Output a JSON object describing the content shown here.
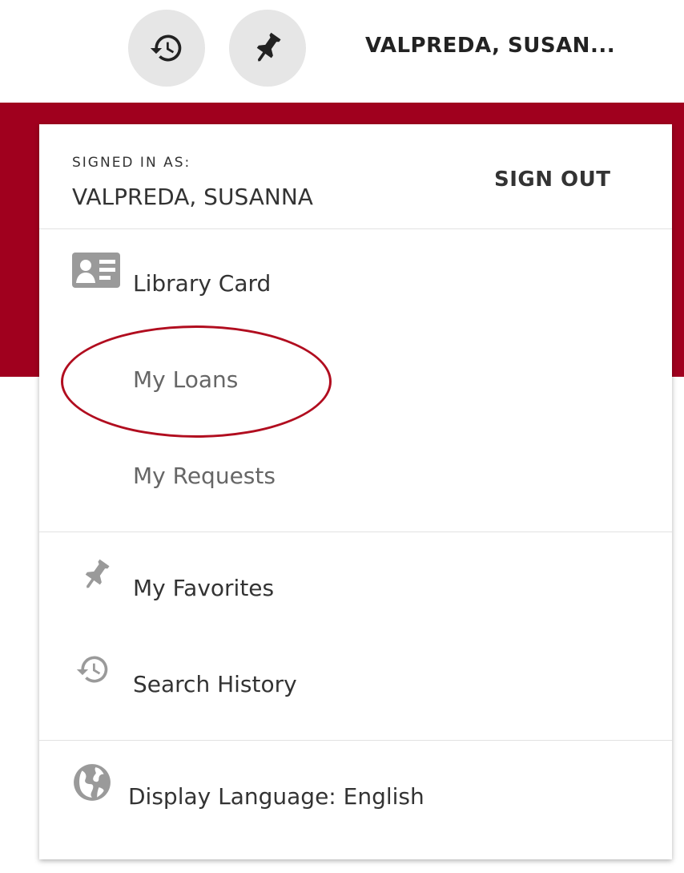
{
  "header": {
    "history_icon": "history-icon",
    "pin_icon": "pin-icon",
    "username_truncated": "VALPREDA, SUSAN..."
  },
  "menu": {
    "signed_in_label": "SIGNED IN AS:",
    "user_name": "VALPREDA, SUSANNA",
    "sign_out_label": "SIGN OUT",
    "items": [
      {
        "label": "Library Card",
        "icon": "id-card-icon"
      },
      {
        "label": "My Loans",
        "icon": ""
      },
      {
        "label": "My Requests",
        "icon": ""
      },
      {
        "label": "My Favorites",
        "icon": "pin-icon"
      },
      {
        "label": "Search History",
        "icon": "history-icon"
      }
    ],
    "language": {
      "label": "Display Language: English",
      "icon": "globe-icon"
    }
  },
  "colors": {
    "brand_red": "#a0001e",
    "annotation_red": "#b10d1f",
    "text_dark": "#333333",
    "text_muted": "#666666",
    "icon_gray": "#9a9a9a",
    "button_bg": "#e6e6e6"
  }
}
